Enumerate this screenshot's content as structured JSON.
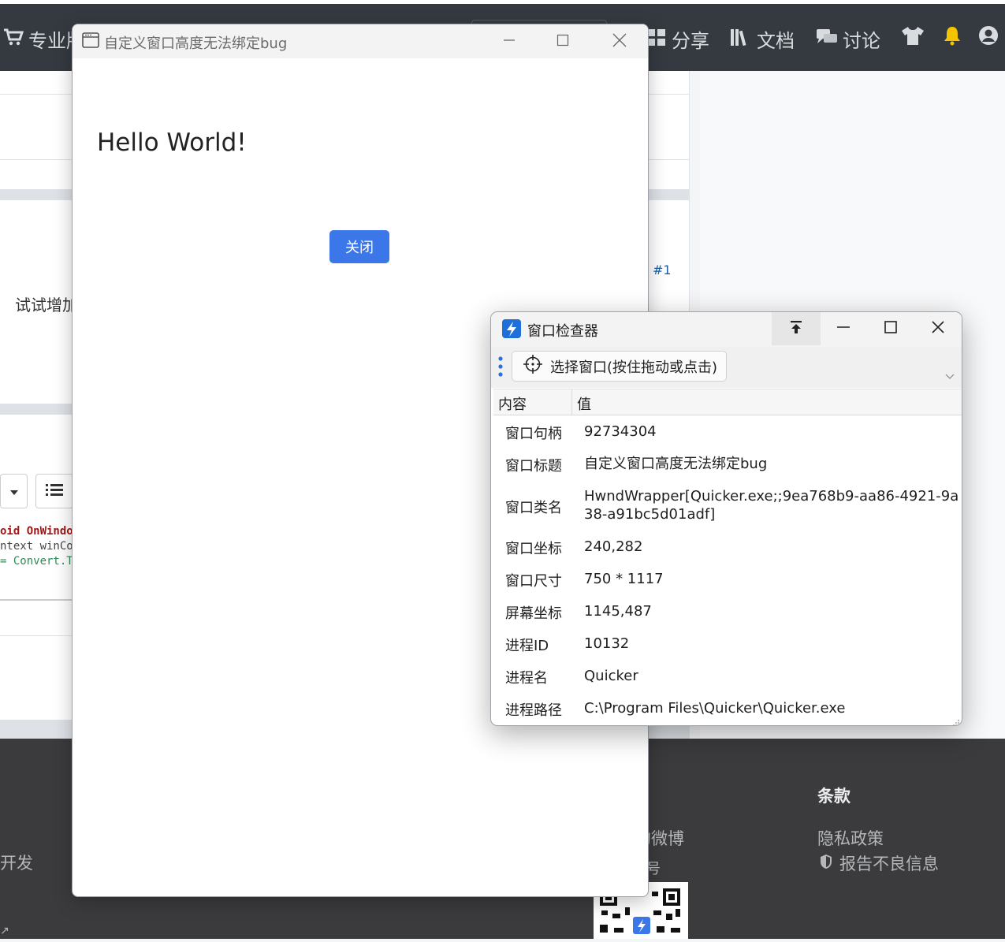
{
  "site": {
    "nav": {
      "pro_label": "专业版",
      "share_label": "分享",
      "docs_label": "文档",
      "discuss_label": "讨论"
    },
    "post": {
      "reply_ref": "#1",
      "comment_snippet": "试试增加"
    },
    "code_lines": [
      "oid OnWindo",
      "ntext winCo",
      "= Convert.T"
    ],
    "footer": {
      "terms_heading": "条款",
      "privacy_link": "隐私政策",
      "report_link": "报告不良信息",
      "weibo_fragment": "的微博",
      "account_fragment": "号",
      "dev_fragment": "开发"
    }
  },
  "hello_window": {
    "title": "自定义窗口高度无法绑定bug",
    "greeting": "Hello World!",
    "close_button": "关闭"
  },
  "inspector": {
    "title": "窗口检查器",
    "pick_button": "选择窗口(按住拖动或点击)",
    "columns": [
      "内容",
      "值"
    ],
    "rows": [
      {
        "key": "窗口句柄",
        "value": "92734304"
      },
      {
        "key": "窗口标题",
        "value": "自定义窗口高度无法绑定bug"
      },
      {
        "key": "窗口类名",
        "value": "HwndWrapper[Quicker.exe;;9ea768b9-aa86-4921-9a38-a91bc5d01adf]"
      },
      {
        "key": "窗口坐标",
        "value": "240,282"
      },
      {
        "key": "窗口尺寸",
        "value": "750 * 1117"
      },
      {
        "key": "屏幕坐标",
        "value": "1145,487"
      },
      {
        "key": "进程ID",
        "value": "10132"
      },
      {
        "key": "进程名",
        "value": "Quicker"
      },
      {
        "key": "进程路径",
        "value": "C:\\Program Files\\Quicker\\Quicker.exe"
      }
    ]
  },
  "colors": {
    "navbar": "#343a40",
    "footer": "#3b3b3d",
    "accent_button": "#3b77e8",
    "bell": "#f5c400",
    "link": "#1a5fa8"
  }
}
